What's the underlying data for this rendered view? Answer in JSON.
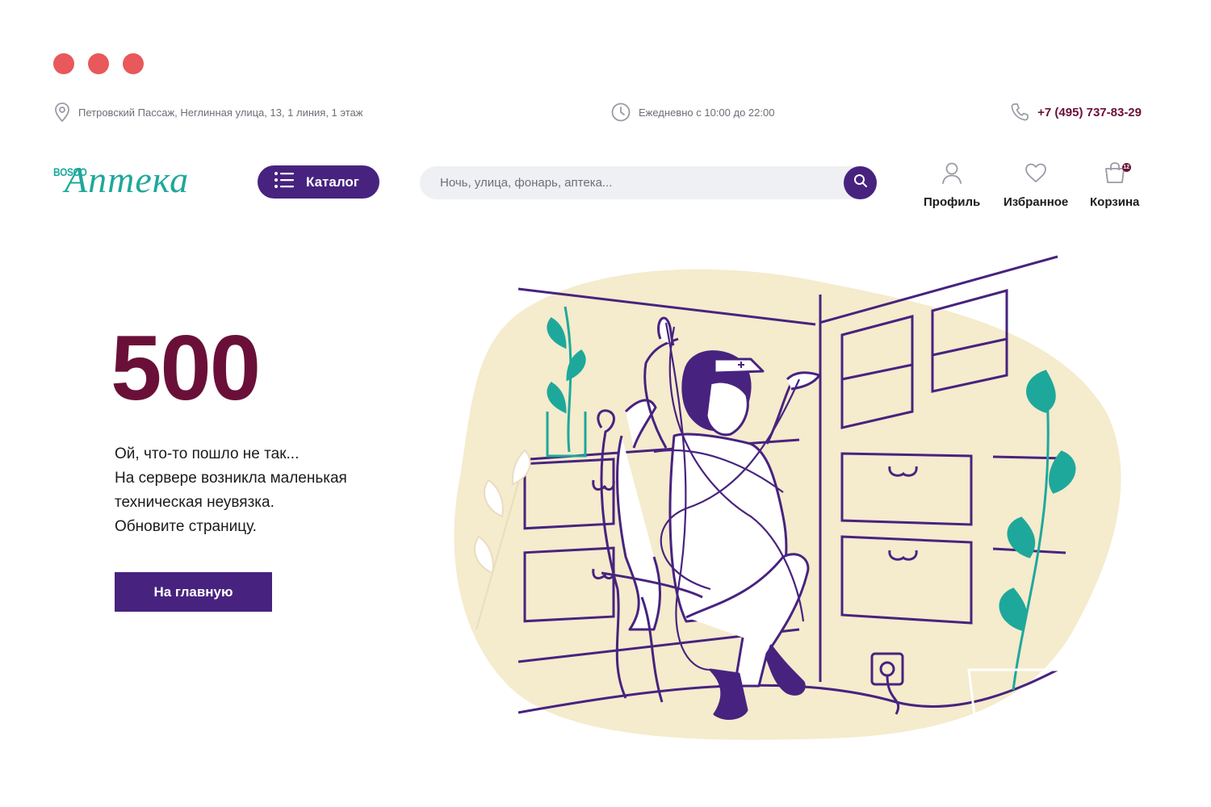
{
  "colors": {
    "accent": "#47237f",
    "brand_teal": "#1ea89b",
    "wine": "#6a1038",
    "window_dot": "#e9585a",
    "search_bg": "#eff0f4",
    "blob": "#f5ebcd"
  },
  "window": {
    "controls": [
      "dot-1",
      "dot-2",
      "dot-3"
    ]
  },
  "topbar": {
    "address": "Петровский Пассаж, Неглинная улица, 13, 1 линия, 1 этаж",
    "address_icon": "location-pin-icon",
    "hours": "Ежедневно с 10:00 до 22:00",
    "hours_icon": "clock-icon",
    "phone": "+7 (495) 737-83-29",
    "phone_icon": "phone-icon"
  },
  "header": {
    "logo_small": "BOSCO",
    "logo_main": "Аптека",
    "catalog_label": "Каталог",
    "catalog_icon": "menu-list-icon",
    "search_placeholder": "Ночь, улица, фонарь, аптека...",
    "search_icon": "search-icon",
    "profile_label": "Профиль",
    "favorites_label": "Избранное",
    "cart_label": "Корзина",
    "cart_count": "12"
  },
  "main": {
    "error_code": "500",
    "message_lines": [
      "Ой, что-то пошло не так...",
      "На сервере возникла маленькая",
      "техническая неувязка.",
      "Обновите страницу."
    ],
    "home_button": "На главную"
  }
}
